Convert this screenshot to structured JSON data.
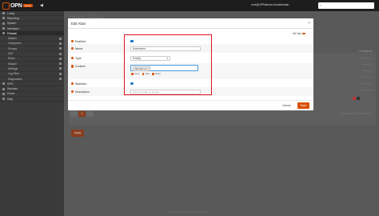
{
  "topbar": {
    "logo_text": "OPN",
    "logo_badge": "sense",
    "user_host": "root@OPNsense.localdomain",
    "search_placeholder": "",
    "collapse_glyph": "◀"
  },
  "sidebar": {
    "items": [
      {
        "label": "Lobby",
        "icon": "lobby-icon"
      },
      {
        "label": "Reporting",
        "icon": "reporting-icon"
      },
      {
        "label": "System",
        "icon": "system-icon"
      },
      {
        "label": "Interfaces",
        "icon": "interfaces-icon"
      },
      {
        "label": "Firewall",
        "icon": "firewall-icon",
        "active": true
      },
      {
        "label": "Aliases",
        "sub": true,
        "icon": "list-icon"
      },
      {
        "label": "Categories",
        "sub": true,
        "icon": "tag-icon"
      },
      {
        "label": "Groups",
        "sub": true,
        "icon": "group-icon"
      },
      {
        "label": "NAT",
        "sub": true,
        "icon": "nat-icon"
      },
      {
        "label": "Rules",
        "sub": true,
        "icon": "rules-icon"
      },
      {
        "label": "Shaper",
        "sub": true,
        "icon": "shaper-icon"
      },
      {
        "label": "Settings",
        "sub": true,
        "icon": "settings-icon"
      },
      {
        "label": "Log Files",
        "sub": true,
        "icon": "log-icon"
      },
      {
        "label": "Diagnostics",
        "sub": true,
        "icon": "diagnostics-icon"
      },
      {
        "label": "VPN",
        "icon": "vpn-icon"
      },
      {
        "label": "Services",
        "icon": "services-icon"
      },
      {
        "label": "Power",
        "icon": "power-icon"
      },
      {
        "label": "Help",
        "icon": "help-icon"
      }
    ]
  },
  "background": {
    "page_title": "Firewall: Aliases",
    "commands_label": "Commands",
    "showing_text": "Showing 1 to 8 of 8 entries",
    "pager": [
      "«",
      "1",
      "»"
    ],
    "apply_label": "Apply",
    "footer_text": "OPNsense (c) 2014-2024 Deciso B.V."
  },
  "modal": {
    "title": "Edit Alias",
    "close_glyph": "×",
    "full_help_label": "full help",
    "fields": {
      "enabled": {
        "label": "Enabled"
      },
      "name": {
        "label": "Name",
        "value": "Untertrennt"
      },
      "type": {
        "label": "Type",
        "value": "Host(s)"
      },
      "content": {
        "label": "Content",
        "tag": "192.168.1.4 ×"
      },
      "statistics": {
        "label": "Statistics"
      },
      "description": {
        "label": "Description",
        "placeholder": "Libp Full node on remote"
      }
    },
    "tag_actions": [
      "Import",
      "Clear",
      "Select"
    ],
    "cancel_label": "Cancel",
    "save_label": "Save"
  },
  "colors": {
    "accent": "#d94f00",
    "highlight": "#e0141e",
    "checkbox": "#1c79c8"
  }
}
